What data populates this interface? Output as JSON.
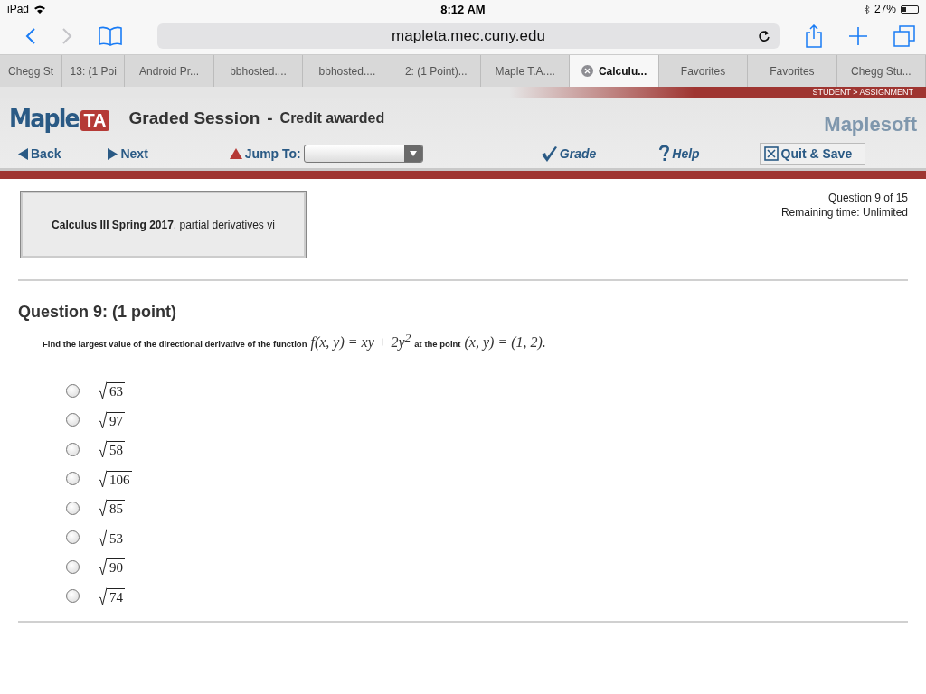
{
  "status_bar": {
    "device": "iPad",
    "time": "8:12 AM",
    "battery": "27%"
  },
  "address_bar": {
    "url": "mapleta.mec.cuny.edu"
  },
  "tabs": [
    {
      "label": "Chegg St",
      "selected": false
    },
    {
      "label": "13: (1 Poi",
      "selected": false
    },
    {
      "label": "Android Pr...",
      "selected": false
    },
    {
      "label": "bbhosted....",
      "selected": false
    },
    {
      "label": "bbhosted....",
      "selected": false
    },
    {
      "label": "2: (1 Point)...",
      "selected": false
    },
    {
      "label": "Maple T.A....",
      "selected": false
    },
    {
      "label": "Calculu...",
      "selected": true
    },
    {
      "label": "Favorites",
      "selected": false
    },
    {
      "label": "Favorites",
      "selected": false
    },
    {
      "label": "Chegg Stu...",
      "selected": false
    }
  ],
  "header": {
    "breadcrumb": "STUDENT > ASSIGNMENT",
    "logo_word": "Maple",
    "logo_badge": "TA",
    "title": "Graded Session",
    "separator": "-",
    "subtitle": "Credit awarded",
    "brand": "Maplesoft"
  },
  "toolbar": [
    {
      "kind": "back",
      "label": "Back"
    },
    {
      "kind": "next",
      "label": "Next"
    },
    {
      "kind": "jump",
      "label": "Jump To:"
    },
    {
      "kind": "grade",
      "label": "Grade"
    },
    {
      "kind": "help",
      "label": "Help"
    },
    {
      "kind": "quit",
      "label": "Quit & Save"
    }
  ],
  "assignment": {
    "text": "**Calculus III Spring 2017**, partial derivatives vi"
  },
  "progress": {
    "question": "Question 9 of 15",
    "time": "Remaining time: Unlimited"
  },
  "question": {
    "title": "Question 9: (1 point)",
    "prompt": "Find the largest value of the directional derivative of the function",
    "formula": "f(x, y) = xy + 2y$^{2}$",
    "connector": "at the point",
    "point": "(x, y) = (1, 2)."
  },
  "choices": [
    {
      "value": "63",
      "selected": false
    },
    {
      "value": "97",
      "selected": false
    },
    {
      "value": "58",
      "selected": false
    },
    {
      "value": "106",
      "selected": false
    },
    {
      "value": "85",
      "selected": false
    },
    {
      "value": "53",
      "selected": false
    },
    {
      "value": "90",
      "selected": false
    },
    {
      "value": "74",
      "selected": false
    }
  ]
}
